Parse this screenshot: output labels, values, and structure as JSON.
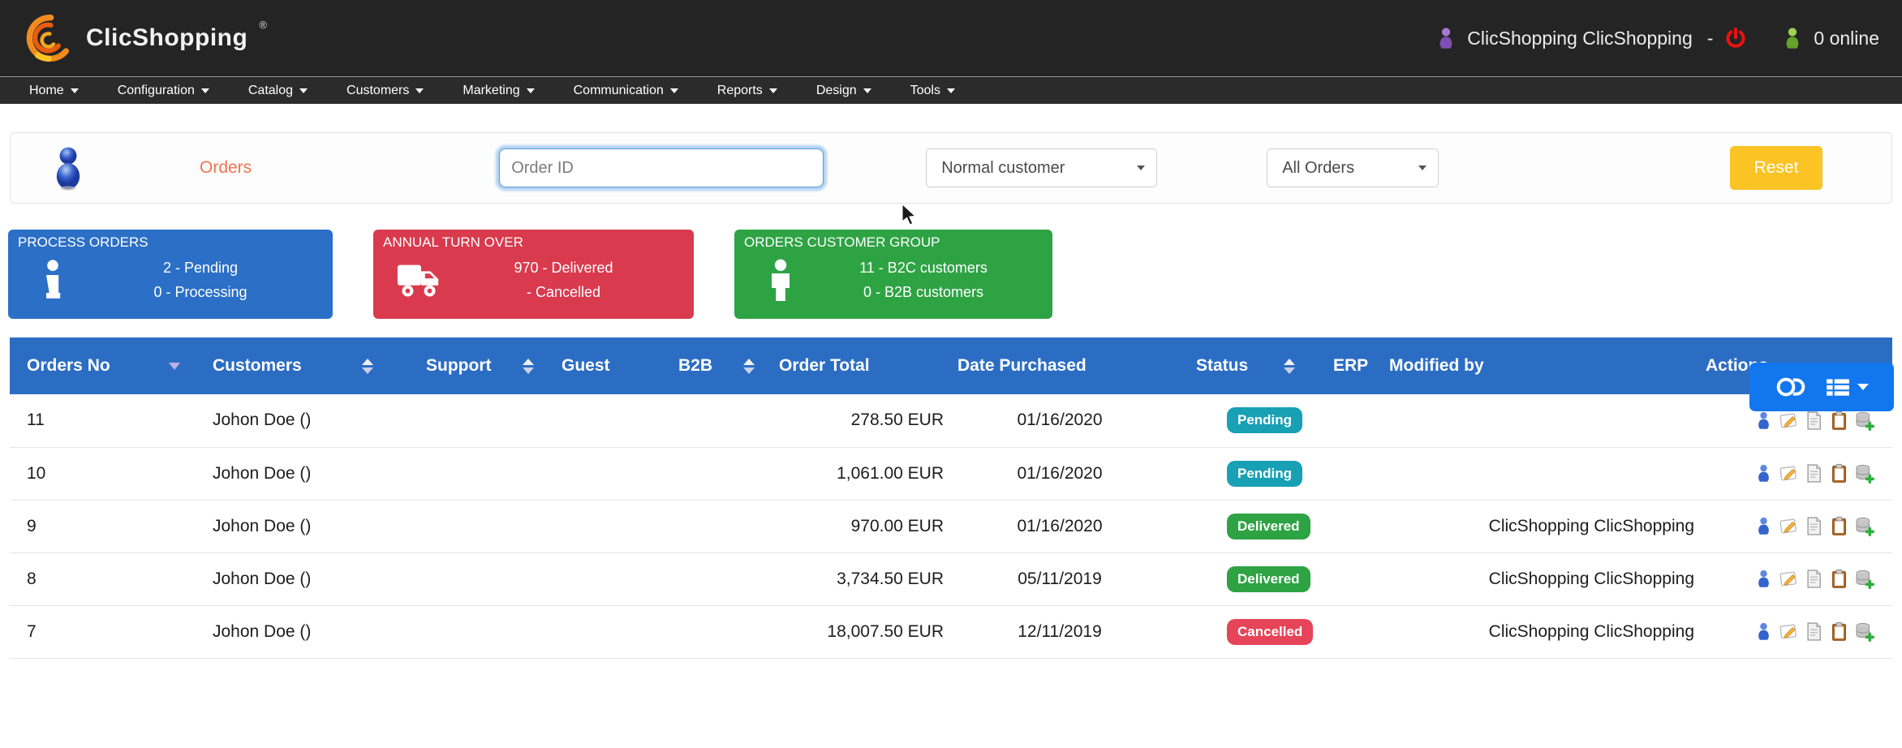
{
  "header": {
    "brand": "ClicShopping",
    "brand_reg": "®",
    "user_name": "ClicShopping ClicShopping",
    "separator": "-",
    "online_count": "0 online"
  },
  "nav": {
    "items": [
      {
        "label": "Home"
      },
      {
        "label": "Configuration"
      },
      {
        "label": "Catalog"
      },
      {
        "label": "Customers"
      },
      {
        "label": "Marketing"
      },
      {
        "label": "Communication"
      },
      {
        "label": "Reports"
      },
      {
        "label": "Design"
      },
      {
        "label": "Tools"
      }
    ]
  },
  "filter": {
    "title": "Orders",
    "order_id_placeholder": "Order ID",
    "customer_group_selected": "Normal customer",
    "order_status_selected": "All Orders",
    "reset_label": "Reset"
  },
  "stat_cards": [
    {
      "title": "PROCESS ORDERS",
      "icon": "info-icon",
      "color": "#2c6fc6",
      "lines": [
        "2 - Pending",
        "0 - Processing"
      ]
    },
    {
      "title": "ANNUAL TURN OVER",
      "icon": "truck-icon",
      "color": "#d93a4e",
      "lines": [
        "970 - Delivered",
        "- Cancelled"
      ]
    },
    {
      "title": "ORDERS CUSTOMER GROUP",
      "icon": "person-icon",
      "color": "#2ea344",
      "lines": [
        "11 - B2C customers",
        "0 - B2B customers"
      ]
    }
  ],
  "table": {
    "columns": [
      "Orders No",
      "Customers",
      "Support",
      "Guest",
      "B2B",
      "Order Total",
      "Date Purchased",
      "Status",
      "ERP",
      "Modified by",
      "Actions"
    ],
    "rows": [
      {
        "no": "11",
        "customer": "Johon Doe ()",
        "support": "",
        "guest": "",
        "b2b": "",
        "total": "278.50 EUR",
        "date": "01/16/2020",
        "status": "Pending",
        "status_type": "pending",
        "erp": "",
        "modified_by": ""
      },
      {
        "no": "10",
        "customer": "Johon Doe ()",
        "support": "",
        "guest": "",
        "b2b": "",
        "total": "1,061.00 EUR",
        "date": "01/16/2020",
        "status": "Pending",
        "status_type": "pending",
        "erp": "",
        "modified_by": ""
      },
      {
        "no": "9",
        "customer": "Johon Doe ()",
        "support": "",
        "guest": "",
        "b2b": "",
        "total": "970.00 EUR",
        "date": "01/16/2020",
        "status": "Delivered",
        "status_type": "delivered",
        "erp": "",
        "modified_by": "ClicShopping ClicShopping"
      },
      {
        "no": "8",
        "customer": "Johon Doe ()",
        "support": "",
        "guest": "",
        "b2b": "",
        "total": "3,734.50 EUR",
        "date": "05/11/2019",
        "status": "Delivered",
        "status_type": "delivered",
        "erp": "",
        "modified_by": "ClicShopping ClicShopping"
      },
      {
        "no": "7",
        "customer": "Johon Doe ()",
        "support": "",
        "guest": "",
        "b2b": "",
        "total": "18,007.50 EUR",
        "date": "12/11/2019",
        "status": "Cancelled",
        "status_type": "cancelled",
        "erp": "",
        "modified_by": "ClicShopping ClicShopping"
      }
    ]
  },
  "icons": {
    "logo": "clicshopping-swirl-icon",
    "admin_user": "person-purple-icon",
    "logout": "power-icon",
    "online": "person-green-icon",
    "panel": "person-blue-icon",
    "view_toggle": "toggle-icon",
    "view_list": "list-icon",
    "row_actions": [
      "customer-icon",
      "edit-icon",
      "invoice-icon",
      "packing-slip-icon",
      "add-record-icon"
    ]
  },
  "colors": {
    "header_bg": "#242424",
    "nav_bg": "#2b2b2b",
    "accent_blue": "#2c6dc4",
    "button_blue": "#1277ee",
    "card_red": "#d93a4e",
    "card_green": "#2ea344",
    "reset_yellow": "#fcc324",
    "badge_pending": "#18a0b4",
    "badge_delivered": "#2ea344",
    "badge_cancelled": "#e64458",
    "title_orange": "#ee744e"
  }
}
